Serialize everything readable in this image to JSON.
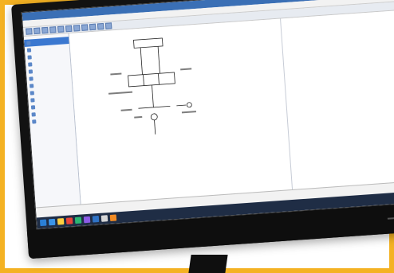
{
  "window": {
    "title": "",
    "menu": [
      "",
      "",
      "",
      "",
      "",
      "",
      "",
      ""
    ]
  },
  "canvas": {
    "title": ""
  },
  "sidebar": {
    "items": [
      {
        "label": "",
        "icon": "component-icon",
        "selected": true
      },
      {
        "label": "",
        "icon": "component-icon"
      },
      {
        "label": "",
        "icon": "component-icon"
      },
      {
        "label": "",
        "icon": "component-icon"
      },
      {
        "label": "",
        "icon": "component-icon"
      },
      {
        "label": "",
        "icon": "component-icon"
      },
      {
        "label": "",
        "icon": "component-icon"
      },
      {
        "label": "",
        "icon": "component-icon"
      },
      {
        "label": "",
        "icon": "component-icon"
      },
      {
        "label": "",
        "icon": "component-icon"
      },
      {
        "label": "",
        "icon": "component-icon"
      },
      {
        "label": "",
        "icon": "component-icon"
      }
    ]
  },
  "status": {
    "text": ""
  },
  "colors": {
    "accent": "#3b78d0",
    "frame": "#f4b223",
    "taskbar": "#1f2d45"
  }
}
